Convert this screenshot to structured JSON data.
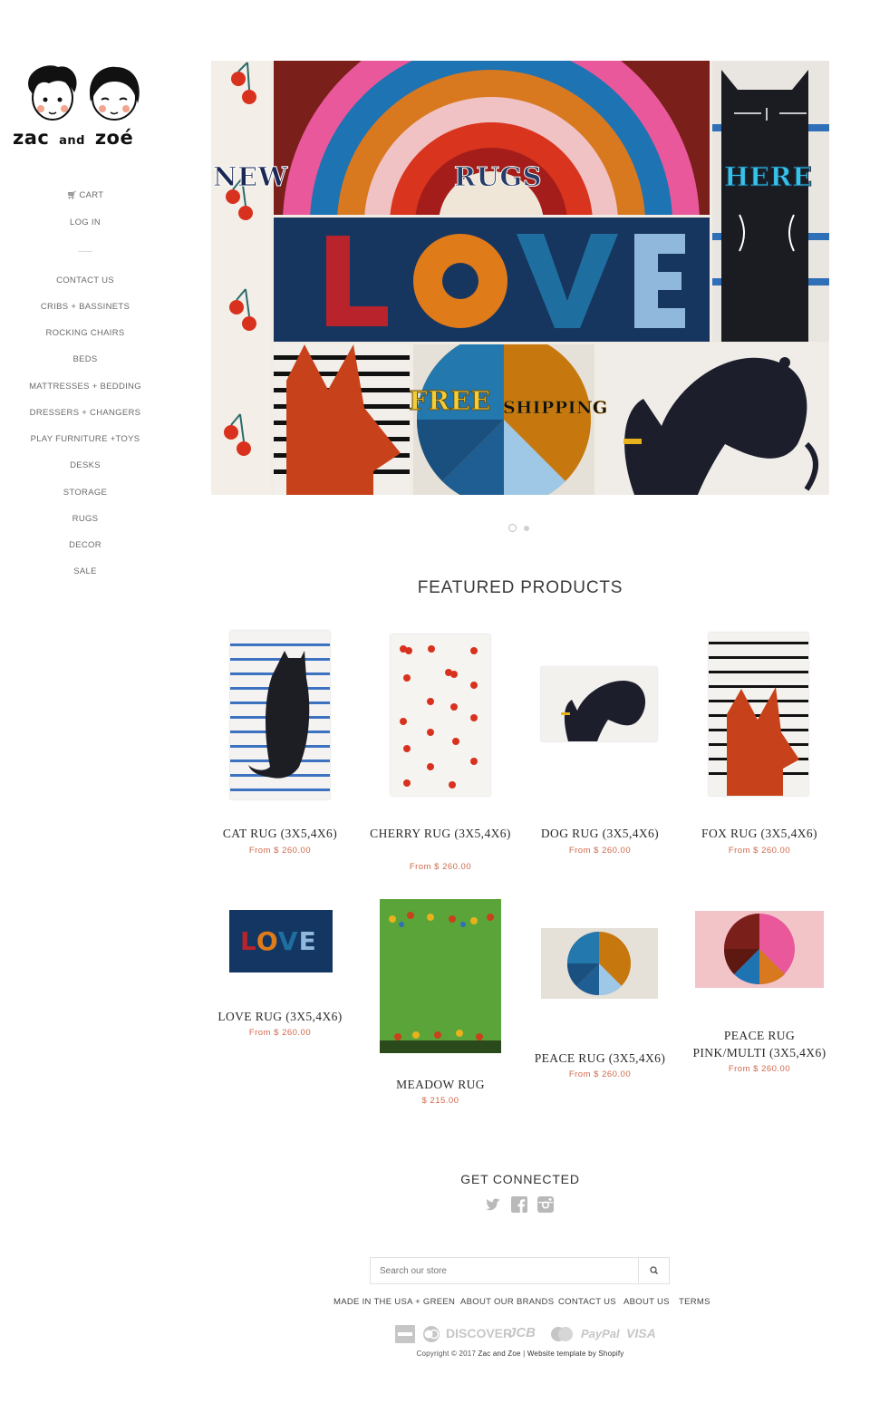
{
  "brand": {
    "name_part1": "zac",
    "name_and": "and",
    "name_part2": "zoé"
  },
  "sidebar": {
    "cart_label": "CART",
    "login_label": "LOG IN",
    "nav": [
      {
        "label": "CONTACT US"
      },
      {
        "label": "CRIBS + BASSINETS"
      },
      {
        "label": "ROCKING CHAIRS"
      },
      {
        "label": "BEDS"
      },
      {
        "label": "MATTRESSES + BEDDING"
      },
      {
        "label": "DRESSERS + CHANGERS"
      },
      {
        "label": "PLAY FURNITURE +TOYS"
      },
      {
        "label": "DESKS"
      },
      {
        "label": "STORAGE"
      },
      {
        "label": "RUGS"
      },
      {
        "label": "DECOR"
      },
      {
        "label": "SALE"
      }
    ]
  },
  "slideshow": {
    "words": {
      "new": "NEW",
      "rugs": "RUGS",
      "here": "HERE",
      "love": "LOVE",
      "free": "FREE",
      "shipping": "SHIPPING"
    },
    "slide_count": 2,
    "active_slide": 1
  },
  "featured": {
    "title": "FEATURED PRODUCTS",
    "products": [
      {
        "name": "CAT RUG (3X5,4X6)",
        "price": "From $ 260.00"
      },
      {
        "name": "CHERRY RUG (3X5,4X6)",
        "price": "From $ 260.00"
      },
      {
        "name": "DOG RUG (3X5,4X6)",
        "price": "From $ 260.00"
      },
      {
        "name": "FOX RUG (3X5,4X6)",
        "price": "From $ 260.00"
      },
      {
        "name": "LOVE RUG (3X5,4X6)",
        "price": "From $ 260.00"
      },
      {
        "name": "MEADOW RUG",
        "price": "$ 215.00"
      },
      {
        "name": "PEACE RUG (3X5,4X6)",
        "price": "From $ 260.00"
      },
      {
        "name": "PEACE RUG PINK/MULTI (3X5,4X6)",
        "price": "From $ 260.00"
      }
    ],
    "love_rug_letters": [
      "L",
      "O",
      "V",
      "E"
    ]
  },
  "footer": {
    "connect_title": "GET CONNECTED",
    "social": [
      "twitter-icon",
      "facebook-icon",
      "instagram-icon"
    ],
    "search_placeholder": "Search our store",
    "links": [
      {
        "label": "MADE IN THE USA + GREEN"
      },
      {
        "label": "ABOUT OUR BRANDS"
      },
      {
        "label": "CONTACT US"
      },
      {
        "label": "ABOUT US"
      },
      {
        "label": "TERMS"
      }
    ],
    "payments": [
      "American Express",
      "Diners",
      "DISCOVER",
      "JCB",
      "MasterCard",
      "PayPal",
      "VISA"
    ],
    "copyright_prefix": "Copyright © 2017",
    "copyright_owner": "Zac and Zoe",
    "copyright_sep": "|",
    "copyright_template": "Website template by Shopify"
  },
  "colors": {
    "price": "#d0684b",
    "text": "#333333",
    "nav_text": "#6b6b6b"
  }
}
